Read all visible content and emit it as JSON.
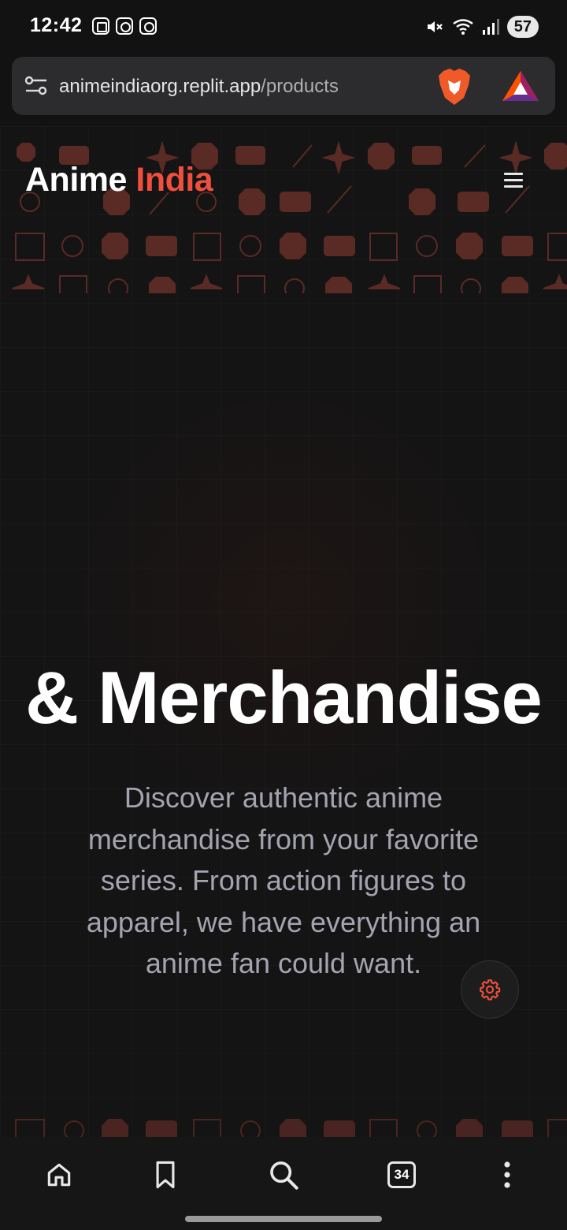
{
  "status_bar": {
    "time": "12:42",
    "left_icons": [
      "screenshot-icon",
      "instagram-icon",
      "instagram-icon"
    ],
    "right_icons": [
      "mute-icon",
      "wifi-icon",
      "signal-icon"
    ],
    "battery": "57"
  },
  "browser": {
    "url_domain": "animeindiaorg.replit.app",
    "url_path": "/products",
    "icons": [
      "site-settings-icon",
      "brave-icon",
      "bat-rewards-icon"
    ]
  },
  "site": {
    "brand_main": "Anime",
    "brand_accent": "India",
    "accent_color": "#ef4f3c"
  },
  "hero": {
    "title": "& Merchandise",
    "description": "Discover authentic anime merchandise from your favorite series. From action figures to apparel, we have everything an anime fan could want."
  },
  "bottom_nav": {
    "tab_count": "34",
    "items": [
      "home-icon",
      "bookmark-icon",
      "search-icon",
      "tabs-icon",
      "more-icon"
    ]
  }
}
